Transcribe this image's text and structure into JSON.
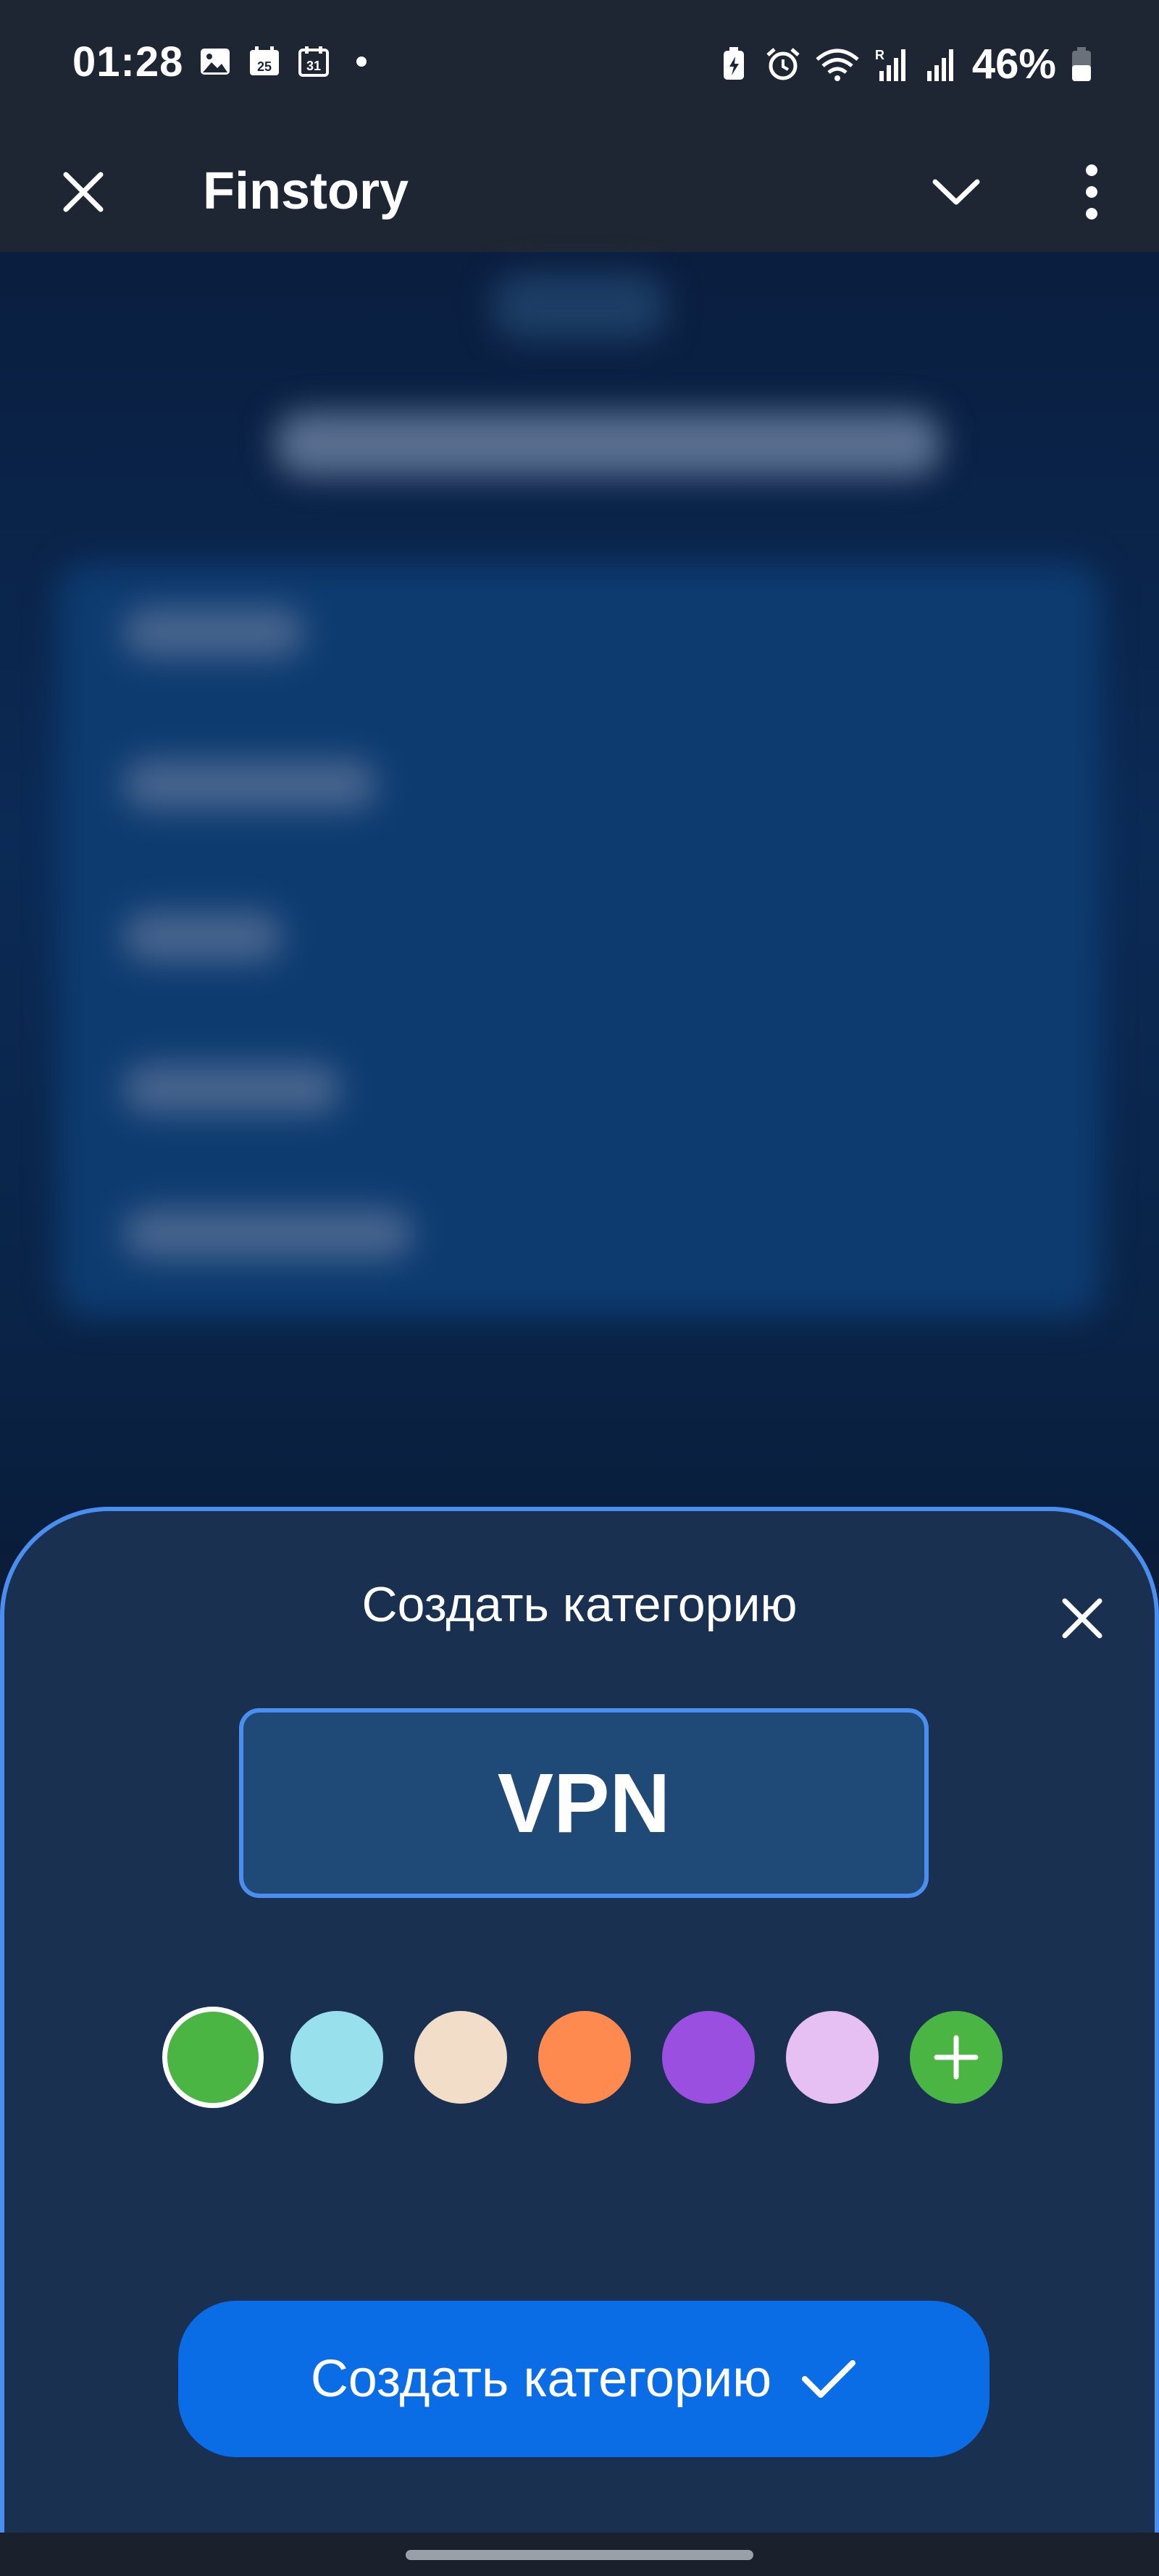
{
  "status_bar": {
    "time": "01:28",
    "calendar_day_a": "25",
    "calendar_day_b": "31",
    "battery_percent": "46%"
  },
  "app_bar": {
    "title": "Finstory",
    "icons": [
      "close-icon",
      "chevron-down-icon",
      "more-vert-icon"
    ]
  },
  "sheet": {
    "title": "Создать категорию",
    "name_value": "VPN",
    "colors": [
      "#4bb543",
      "#97e0ec",
      "#f2dec8",
      "#ff8a4f",
      "#9a4fe0",
      "#e6c0f3"
    ],
    "selected_color_index": 0,
    "add_color_bg": "#4bb543",
    "create_button_label": "Создать категорию"
  },
  "theme": {
    "accent": "#0a6de6",
    "sheet_bg": "#193050",
    "border": "#4a8ef0"
  }
}
